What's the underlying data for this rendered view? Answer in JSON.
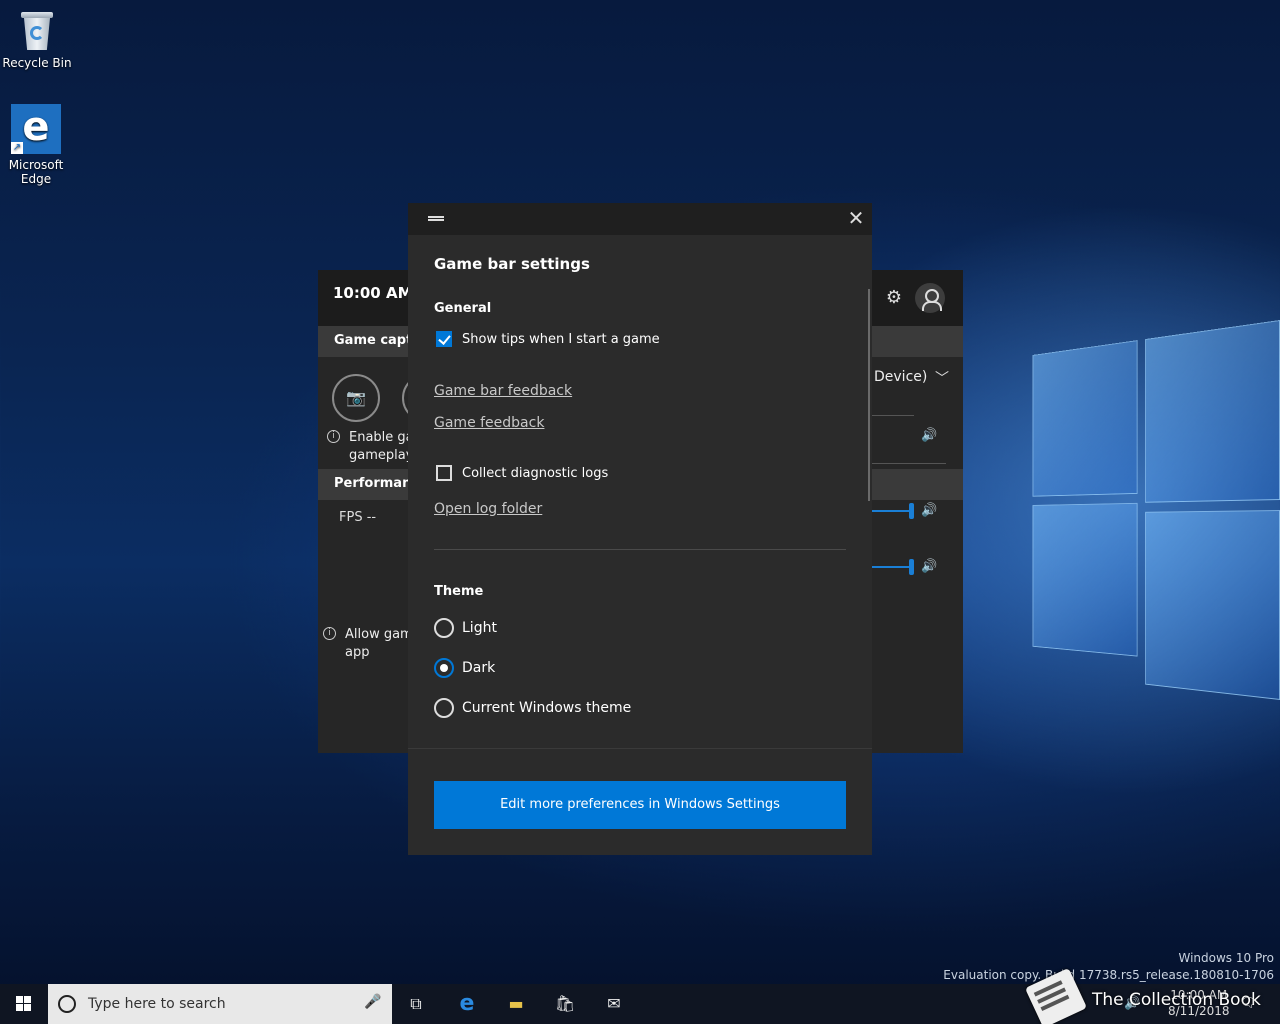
{
  "desktop": {
    "icons": [
      {
        "label": "Recycle Bin"
      },
      {
        "label": "Microsoft Edge"
      }
    ],
    "watermark": {
      "line1": "Windows 10 Pro",
      "line2": "Evaluation copy. Build 17738.rs5_release.180810-1706"
    }
  },
  "gamebar": {
    "time": "10:00 AM",
    "capture_header": "Game captu",
    "enable_text_1": "Enable ga",
    "enable_text_2": "gameplay",
    "performance_header": "Performanc",
    "fps": "FPS --",
    "allow_text_1": "Allow gam",
    "allow_text_2": "app",
    "device": "Device)"
  },
  "dialog": {
    "title": "Game bar settings",
    "general_label": "General",
    "show_tips": {
      "label": "Show tips when I start a game",
      "checked": true
    },
    "links": [
      "Game bar feedback",
      "Game feedback"
    ],
    "collect_logs": {
      "label": "Collect diagnostic logs",
      "checked": false
    },
    "open_log_link": "Open log folder",
    "theme_label": "Theme",
    "theme_options": [
      {
        "label": "Light",
        "selected": false
      },
      {
        "label": "Dark",
        "selected": true
      },
      {
        "label": "Current Windows theme",
        "selected": false
      }
    ],
    "settings_button": "Edit more preferences in Windows Settings"
  },
  "taskbar": {
    "search_placeholder": "Type here to search",
    "time": "10:00 AM",
    "date": "8/11/2018",
    "brand": "The Collection Book"
  },
  "colors": {
    "accent": "#0078d7",
    "dialog_bg": "#2b2b2b",
    "titlebar_bg": "#1f1f1f"
  }
}
